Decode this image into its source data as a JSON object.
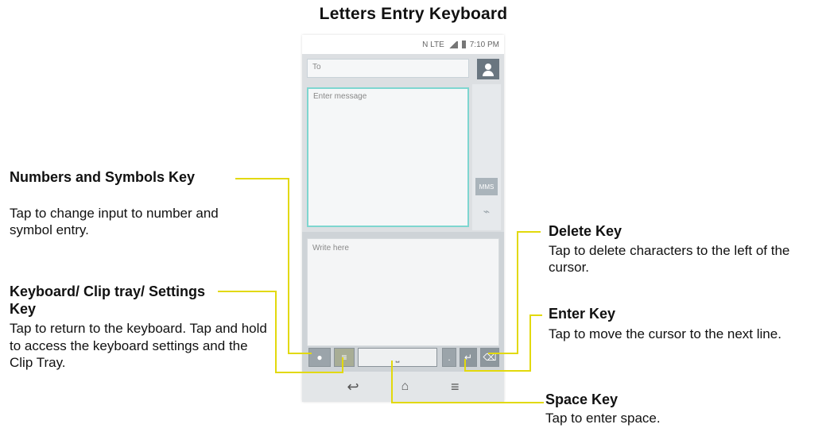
{
  "title": "Letters Entry Keyboard",
  "phone": {
    "status_time": "7:10 PM",
    "status_flags": "N LTE",
    "to_placeholder": "To",
    "message_placeholder": "Enter message",
    "write_placeholder": "Write here",
    "mms_label": "MMS",
    "icons": [
      "contact-icon",
      "attach-icon",
      "back-icon",
      "home-icon",
      "menu-icon",
      "enter-icon",
      "delete-icon",
      "space-icon",
      "numbers-symbols-icon",
      "keyboard-clip-settings-icon"
    ]
  },
  "callouts": {
    "numbers_symbols": {
      "head": "Numbers and Symbols Key",
      "body": "Tap to change input to number and symbol entry."
    },
    "keyboard_clip": {
      "head": "Keyboard/ Clip tray/ Settings Key",
      "body": "Tap to return to the keyboard. Tap and hold to access the keyboard settings and the Clip Tray."
    },
    "delete": {
      "head": "Delete Key",
      "body": "Tap to delete characters to the left of the cursor."
    },
    "enter": {
      "head": "Enter Key",
      "body": "Tap to move the cursor to the next line."
    },
    "space": {
      "head": "Space Key",
      "body": "Tap to enter space."
    }
  },
  "colors": {
    "leader_line": "#e2d90c",
    "message_border": "#7ed6d0"
  }
}
